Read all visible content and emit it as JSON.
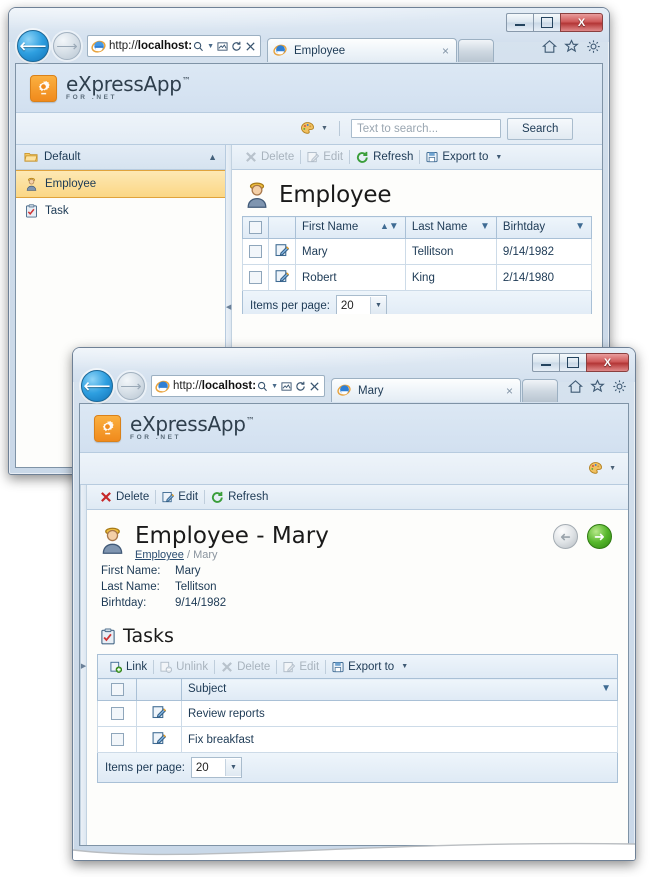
{
  "windows": [
    {
      "id": "employee-list-window",
      "browser": {
        "url_protocol": "http://",
        "url_host": "localhost:",
        "tab_title": "Employee",
        "tab_close": "×",
        "addr_search_icon": "search-icon",
        "addr_compat_icon": "compatibility-view-icon",
        "addr_refresh_icon": "refresh-icon",
        "addr_stop_icon": "stop-icon",
        "min_label": "Minimize",
        "max_label": "Maximize",
        "close_label": "X"
      },
      "app": {
        "logo_title": "eXpressApp",
        "logo_tm": "™",
        "logo_sub": "FOR .NET"
      },
      "search": {
        "placeholder": "Text to search...",
        "value": "",
        "button_label": "Search",
        "theme_icon": "palette-icon"
      },
      "sidebar": {
        "group_label": "Default",
        "items": [
          {
            "label": "Employee",
            "icon": "employee-icon",
            "selected": true
          },
          {
            "label": "Task",
            "icon": "task-icon",
            "selected": false
          }
        ]
      },
      "toolbar": [
        {
          "label": "Delete",
          "icon": "delete-icon",
          "disabled": true,
          "caret": false
        },
        {
          "label": "Edit",
          "icon": "edit-icon",
          "disabled": true,
          "caret": false
        },
        {
          "label": "Refresh",
          "icon": "refresh-icon",
          "disabled": false,
          "caret": false
        },
        {
          "label": "Export to",
          "icon": "export-icon",
          "disabled": false,
          "caret": true
        }
      ],
      "view": {
        "title": "Employee",
        "icon": "employee-icon"
      },
      "grid": {
        "columns": [
          {
            "label": "First Name",
            "sorted": "asc",
            "filter": true
          },
          {
            "label": "Last Name",
            "sorted": "",
            "filter": true
          },
          {
            "label": "Birhtday",
            "sorted": "",
            "filter": true
          }
        ],
        "rows": [
          {
            "first": "Mary",
            "last": "Tellitson",
            "birthday": "9/14/1982"
          },
          {
            "first": "Robert",
            "last": "King",
            "birthday": "2/14/1980"
          }
        ],
        "pager_label": "Items per page:",
        "pager_value": "20"
      }
    },
    {
      "id": "employee-detail-window",
      "browser": {
        "url_protocol": "http://",
        "url_host": "localhost:",
        "tab_title": "Mary",
        "tab_close": "×",
        "close_label": "X"
      },
      "app": {
        "logo_title": "eXpressApp",
        "logo_tm": "™",
        "logo_sub": "FOR .NET"
      },
      "search": {
        "theme_icon": "palette-icon"
      },
      "toolbar": [
        {
          "label": "Delete",
          "icon": "delete-icon",
          "disabled": false
        },
        {
          "label": "Edit",
          "icon": "edit-icon",
          "disabled": false
        },
        {
          "label": "Refresh",
          "icon": "refresh-icon",
          "disabled": false
        }
      ],
      "detail": {
        "title": "Employee - Mary",
        "icon": "employee-icon",
        "breadcrumb_link": "Employee",
        "breadcrumb_sep": "/",
        "breadcrumb_current": "Mary",
        "prev_button": "previous-record-icon",
        "next_button": "next-record-icon",
        "fields": [
          {
            "label": "First Name:",
            "value": "Mary"
          },
          {
            "label": "Last Name:",
            "value": "Tellitson"
          },
          {
            "label": "Birhtday:",
            "value": "9/14/1982"
          }
        ]
      },
      "tasks": {
        "section_title": "Tasks",
        "section_icon": "task-icon",
        "toolbar": [
          {
            "label": "Link",
            "icon": "link-icon",
            "disabled": false,
            "caret": false
          },
          {
            "label": "Unlink",
            "icon": "unlink-icon",
            "disabled": true,
            "caret": false
          },
          {
            "label": "Delete",
            "icon": "delete-icon",
            "disabled": true,
            "caret": false
          },
          {
            "label": "Edit",
            "icon": "edit-icon",
            "disabled": true,
            "caret": false
          },
          {
            "label": "Export to",
            "icon": "export-icon",
            "disabled": false,
            "caret": true
          }
        ],
        "columns": [
          {
            "label": "Subject",
            "filter": true
          }
        ],
        "rows": [
          {
            "subject": "Review reports"
          },
          {
            "subject": "Fix breakfast"
          }
        ],
        "pager_label": "Items per page:",
        "pager_value": "20"
      }
    }
  ],
  "colors": {
    "accent_orange": "#f08a1c",
    "selected_row": "#fbd785",
    "header_blue": "#d2e0f0",
    "grid_border": "#a9c0d6",
    "close_red": "#b33636",
    "link_blue": "#2a4c70",
    "next_green": "#56b72b"
  }
}
